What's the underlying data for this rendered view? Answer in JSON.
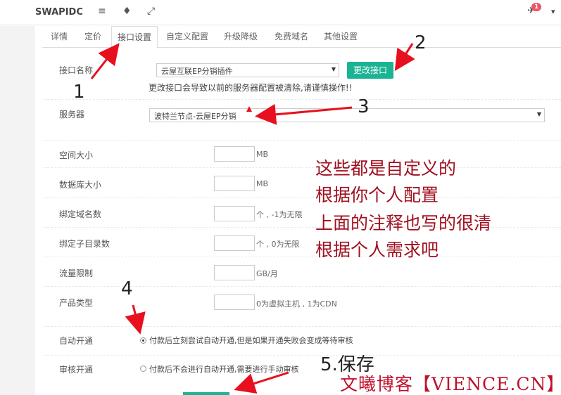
{
  "topbar": {
    "brand": "SWAPIDC",
    "menu_icon": "≡",
    "diamond_icon": "♦",
    "expand_icon": "⤢",
    "notify_count": "1",
    "user_caret": "▾"
  },
  "tabs": [
    "详情",
    "定价",
    "接口设置",
    "自定义配置",
    "升级降级",
    "免费域名",
    "其他设置"
  ],
  "interface": {
    "label": "接口名称",
    "selected": "云屋互联EP分销插件",
    "button": "更改接口",
    "hint": "更改接口会导致以前的服务器配置被清除,请谨慎操作!!"
  },
  "server": {
    "label": "服务器",
    "selected": "波特兰节点-云屋EP分销"
  },
  "fields": [
    {
      "label": "空间大小",
      "unit": "MB"
    },
    {
      "label": "数据库大小",
      "unit": "MB"
    },
    {
      "label": "绑定域名数",
      "unit": "个 , -1为无限"
    },
    {
      "label": "绑定子目录数",
      "unit": "个 , 0为无限"
    },
    {
      "label": "流量限制",
      "unit": "GB/月"
    },
    {
      "label": "产品类型",
      "unit": "0为虚拟主机 , 1为CDN"
    }
  ],
  "auto_open": {
    "label": "自动开通",
    "option": "付款后立刻尝试自动开通,但是如果开通失败会变成等待审核"
  },
  "review_open": {
    "label": "审核开通",
    "option": "付款后不会进行自动开通,需要进行手动审核"
  },
  "annotations": {
    "n1": "1",
    "n2": "2",
    "n3": "3",
    "n4": "4",
    "save": "5.保存",
    "text_lines": [
      "这些都是自定义的",
      "根据你个人配置",
      "上面的注释也写的很清",
      "根据个人需求吧"
    ],
    "watermark": "文曦博客【VIENCE.CN】",
    "arrow_color": "#e8101e"
  }
}
